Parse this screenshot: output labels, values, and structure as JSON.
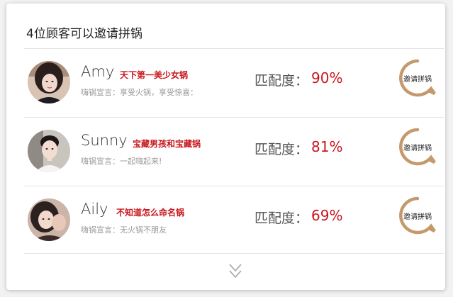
{
  "header": {
    "title": "4位顾客可以邀请拼锅"
  },
  "customers": [
    {
      "name": "Amy",
      "tagline": "天下第一美少女锅",
      "declaration": "嗨锅宣言：享受火锅，享受惊喜：",
      "match_label": "匹配度：",
      "match_value": "90%",
      "invite_label": "邀请拼锅"
    },
    {
      "name": "Sunny",
      "tagline": "宝藏男孩和宝藏锅",
      "declaration": "嗨锅宣言：一起嗨起来!",
      "match_label": "匹配度：",
      "match_value": "81%",
      "invite_label": "邀请拼锅"
    },
    {
      "name": "Aily",
      "tagline": "不知道怎么命名锅",
      "declaration": "嗨锅宣言：无火锅不朋友",
      "match_label": "匹配度：",
      "match_value": "69%",
      "invite_label": "邀请拼锅"
    }
  ],
  "colors": {
    "accent_red": "#c8161d",
    "ring_gold": "#c49a6c",
    "divider": "#e3e3e3"
  },
  "icons": {
    "expand": "double-chevron-down-icon",
    "invite": "speech-ring-icon"
  }
}
